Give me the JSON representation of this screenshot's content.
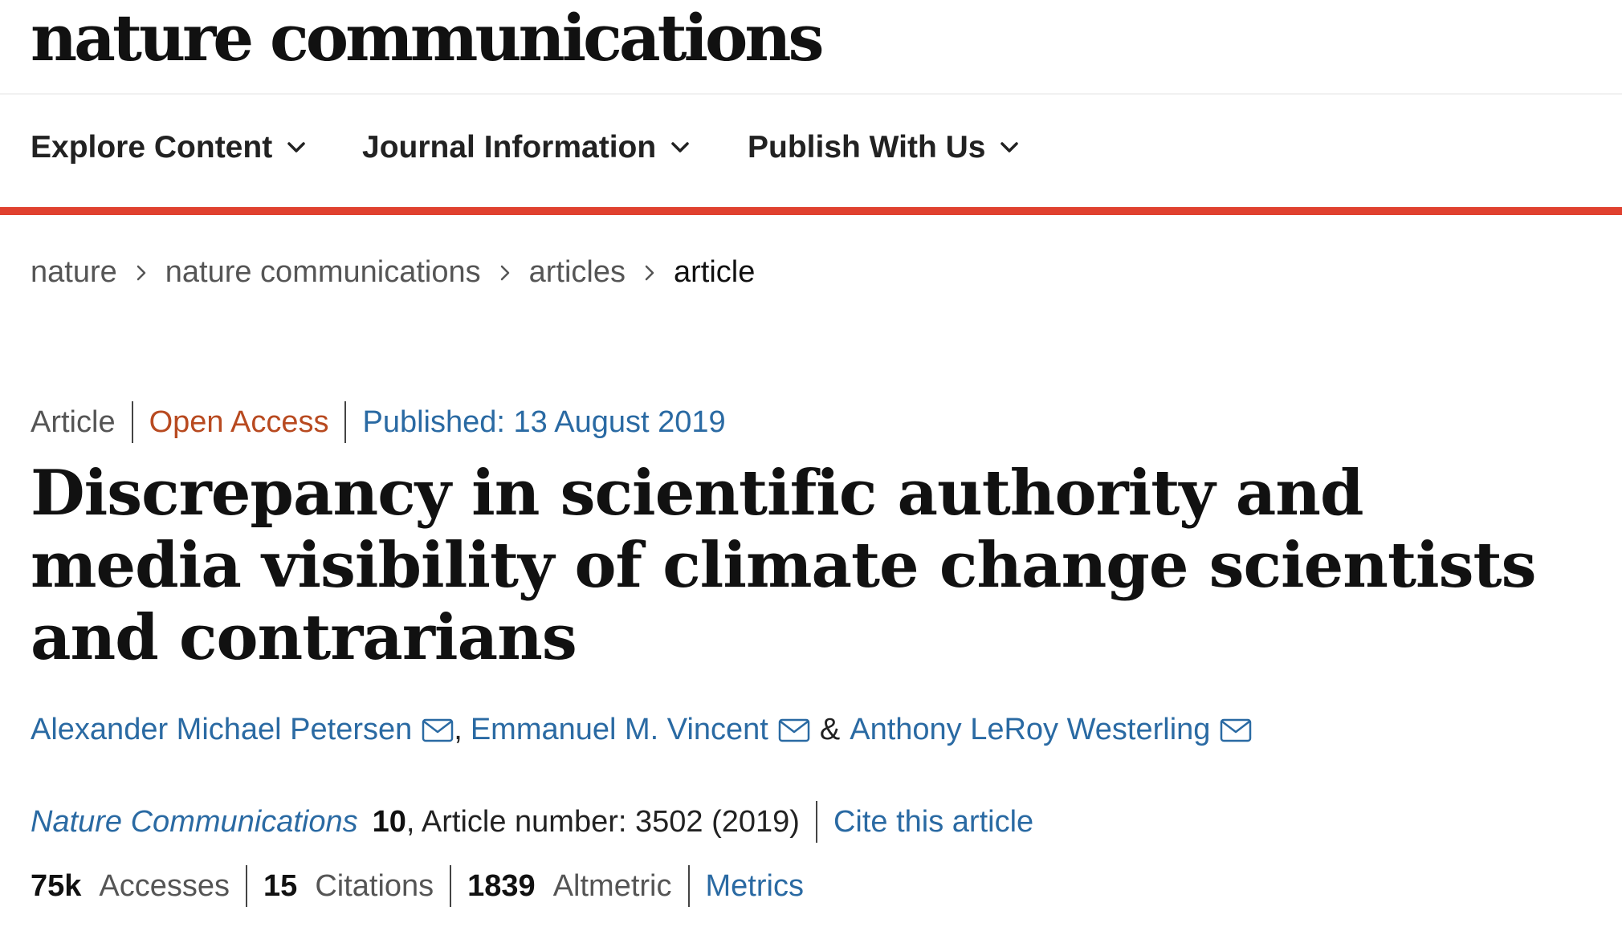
{
  "header": {
    "logo_text": "nature communications"
  },
  "nav": {
    "items": [
      {
        "label": "Explore Content",
        "icon": "chevron-down-icon"
      },
      {
        "label": "Journal Information",
        "icon": "chevron-down-icon"
      },
      {
        "label": "Publish With Us",
        "icon": "chevron-down-icon"
      }
    ],
    "accent_color": "#e0412f"
  },
  "breadcrumb": {
    "items": [
      "nature",
      "nature communications",
      "articles",
      "article"
    ],
    "separator_icon": "chevron-right-icon"
  },
  "article": {
    "type": "Article",
    "access": "Open Access",
    "published": "Published: 13 August 2019",
    "title": "Discrepancy in scientific authority and media visibility of climate change scientists and contrarians",
    "authors": [
      {
        "name": "Alexander Michael Petersen",
        "icon": "envelope-icon"
      },
      {
        "name": "Emmanuel M. Vincent",
        "icon": "envelope-icon"
      },
      {
        "name": "Anthony LeRoy Westerling",
        "icon": "envelope-icon"
      }
    ],
    "author_comma": ",",
    "author_and": "&",
    "journal": "Nature Communications",
    "volume": "10",
    "article_number": ", Article number: 3502 (2019)",
    "cite_label": "Cite this article"
  },
  "metrics": {
    "accesses_value": "75k",
    "accesses_label": "Accesses",
    "citations_value": "15",
    "citations_label": "Citations",
    "altmetric_value": "1839",
    "altmetric_label": "Altmetric",
    "metrics_link": "Metrics"
  },
  "colors": {
    "link": "#2a6aa3",
    "open_access": "#b84a20",
    "accent_bar": "#e0412f"
  }
}
